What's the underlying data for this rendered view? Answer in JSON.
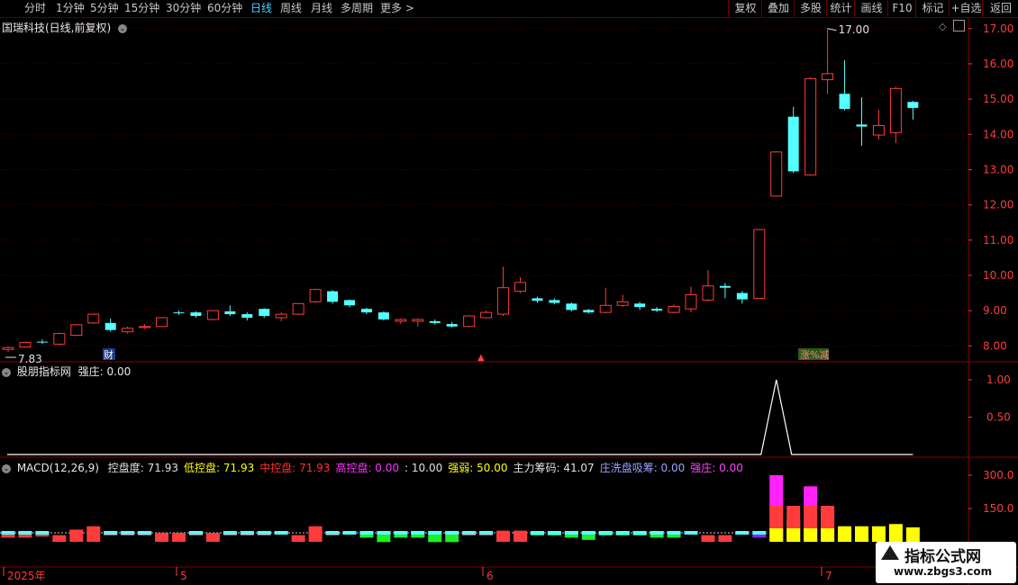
{
  "toolbar": {
    "periods": [
      "分时",
      "1分钟",
      "5分钟",
      "15分钟",
      "30分钟",
      "60分钟",
      "日线",
      "周线",
      "月线",
      "多周期",
      "更多 >"
    ],
    "active_period": "日线",
    "right_buttons": [
      "复权",
      "叠加",
      "多股",
      "统计",
      "画线",
      "F10",
      "标记",
      "+自选",
      "返回"
    ]
  },
  "main_panel": {
    "title": "国瑞科技(日线,前复权)",
    "y_ticks": [
      "17.00",
      "16.00",
      "15.00",
      "14.00",
      "13.00",
      "12.00",
      "11.00",
      "10.00",
      "9.00",
      "8.00"
    ],
    "high_label": "17.00",
    "low_label": "7.83",
    "markers": [
      "财",
      "▲",
      "涨%减"
    ]
  },
  "indicator_panel": {
    "name": "股朋指标网",
    "label": "强庄:",
    "value": "0.00",
    "y_ticks": [
      "1.00",
      "0.50"
    ]
  },
  "macd_panel": {
    "name": "MACD(12,26,9)",
    "items": [
      {
        "label": "控盘度:",
        "value": "71.93",
        "color": "#e0e0e0"
      },
      {
        "label": "低控盘:",
        "value": "71.93",
        "color": "#ffff00"
      },
      {
        "label": "中控盘:",
        "value": "71.93",
        "color": "#ff3030"
      },
      {
        "label": "高控盘:",
        "value": "0.00",
        "color": "#ff30ff"
      },
      {
        "label": ":",
        "value": "10.00",
        "color": "#e0e0e0"
      },
      {
        "label": "强弱:",
        "value": "50.00",
        "color": "#ffff00"
      },
      {
        "label": "主力筹码:",
        "value": "41.07",
        "color": "#e0e0e0"
      },
      {
        "label": "庄洗盘吸筹:",
        "value": "0.00",
        "color": "#a0a0ff"
      },
      {
        "label": "强庄:",
        "value": "0.00",
        "color": "#ff40ff"
      }
    ],
    "y_ticks": [
      "300.0",
      "150.0"
    ]
  },
  "time_axis": [
    "2025年",
    "5",
    "6",
    "7"
  ],
  "watermark": {
    "title": "指标公式网",
    "url": "www.zbgs3.com"
  },
  "chart_data": {
    "type": "candlestick",
    "title": "国瑞科技(日线,前复权)",
    "ylim": [
      7.6,
      17.3
    ],
    "candles": [
      {
        "o": 7.9,
        "c": 7.95,
        "h": 7.98,
        "l": 7.83
      },
      {
        "o": 7.97,
        "c": 8.1,
        "h": 8.12,
        "l": 7.95
      },
      {
        "o": 8.12,
        "c": 8.1,
        "h": 8.18,
        "l": 8.06
      },
      {
        "o": 8.05,
        "c": 8.35,
        "h": 8.38,
        "l": 8.02
      },
      {
        "o": 8.3,
        "c": 8.6,
        "h": 8.62,
        "l": 8.28
      },
      {
        "o": 8.65,
        "c": 8.9,
        "h": 8.92,
        "l": 8.62
      },
      {
        "o": 8.65,
        "c": 8.45,
        "h": 8.78,
        "l": 8.4
      },
      {
        "o": 8.4,
        "c": 8.5,
        "h": 8.55,
        "l": 8.35
      },
      {
        "o": 8.52,
        "c": 8.55,
        "h": 8.62,
        "l": 8.48
      },
      {
        "o": 8.55,
        "c": 8.8,
        "h": 8.82,
        "l": 8.53
      },
      {
        "o": 8.95,
        "c": 8.93,
        "h": 9.0,
        "l": 8.88
      },
      {
        "o": 8.95,
        "c": 8.85,
        "h": 8.98,
        "l": 8.8
      },
      {
        "o": 8.75,
        "c": 9.0,
        "h": 9.02,
        "l": 8.72
      },
      {
        "o": 8.98,
        "c": 8.9,
        "h": 9.15,
        "l": 8.85
      },
      {
        "o": 8.9,
        "c": 8.8,
        "h": 8.95,
        "l": 8.72
      },
      {
        "o": 9.05,
        "c": 8.85,
        "h": 9.07,
        "l": 8.8
      },
      {
        "o": 8.8,
        "c": 8.9,
        "h": 8.95,
        "l": 8.7
      },
      {
        "o": 8.9,
        "c": 9.2,
        "h": 9.22,
        "l": 8.88
      },
      {
        "o": 9.25,
        "c": 9.6,
        "h": 9.62,
        "l": 9.22
      },
      {
        "o": 9.55,
        "c": 9.25,
        "h": 9.58,
        "l": 9.2
      },
      {
        "o": 9.3,
        "c": 9.15,
        "h": 9.32,
        "l": 9.1
      },
      {
        "o": 9.05,
        "c": 8.95,
        "h": 9.08,
        "l": 8.9
      },
      {
        "o": 8.95,
        "c": 8.75,
        "h": 8.98,
        "l": 8.72
      },
      {
        "o": 8.7,
        "c": 8.75,
        "h": 8.78,
        "l": 8.62
      },
      {
        "o": 8.7,
        "c": 8.75,
        "h": 8.78,
        "l": 8.55
      },
      {
        "o": 8.7,
        "c": 8.65,
        "h": 8.75,
        "l": 8.6
      },
      {
        "o": 8.62,
        "c": 8.55,
        "h": 8.68,
        "l": 8.52
      },
      {
        "o": 8.55,
        "c": 8.85,
        "h": 8.87,
        "l": 8.53
      },
      {
        "o": 8.8,
        "c": 8.95,
        "h": 9.0,
        "l": 8.78
      },
      {
        "o": 8.9,
        "c": 9.65,
        "h": 10.25,
        "l": 8.85
      },
      {
        "o": 9.55,
        "c": 9.8,
        "h": 9.95,
        "l": 9.5
      },
      {
        "o": 9.35,
        "c": 9.28,
        "h": 9.4,
        "l": 9.22
      },
      {
        "o": 9.3,
        "c": 9.22,
        "h": 9.35,
        "l": 9.18
      },
      {
        "o": 9.2,
        "c": 9.02,
        "h": 9.23,
        "l": 8.98
      },
      {
        "o": 9.02,
        "c": 8.95,
        "h": 9.05,
        "l": 8.92
      },
      {
        "o": 8.95,
        "c": 9.15,
        "h": 9.65,
        "l": 8.92
      },
      {
        "o": 9.15,
        "c": 9.25,
        "h": 9.45,
        "l": 9.1
      },
      {
        "o": 9.2,
        "c": 9.1,
        "h": 9.25,
        "l": 9.02
      },
      {
        "o": 9.05,
        "c": 9.0,
        "h": 9.1,
        "l": 8.96
      },
      {
        "o": 8.95,
        "c": 9.12,
        "h": 9.17,
        "l": 8.93
      },
      {
        "o": 9.05,
        "c": 9.45,
        "h": 9.68,
        "l": 8.95
      },
      {
        "o": 9.3,
        "c": 9.7,
        "h": 10.15,
        "l": 9.25
      },
      {
        "o": 9.7,
        "c": 9.65,
        "h": 9.78,
        "l": 9.35
      },
      {
        "o": 9.5,
        "c": 9.32,
        "h": 9.55,
        "l": 9.2
      },
      {
        "o": 9.35,
        "c": 11.3,
        "h": 11.32,
        "l": 9.33
      },
      {
        "o": 12.25,
        "c": 13.5,
        "h": 13.52,
        "l": 12.23
      },
      {
        "o": 14.5,
        "c": 12.95,
        "h": 14.78,
        "l": 12.9
      },
      {
        "o": 12.85,
        "c": 15.58,
        "h": 15.62,
        "l": 12.83
      },
      {
        "o": 15.55,
        "c": 15.72,
        "h": 17.0,
        "l": 15.15
      },
      {
        "o": 15.15,
        "c": 14.72,
        "h": 16.1,
        "l": 14.68
      },
      {
        "o": 14.28,
        "c": 14.22,
        "h": 15.05,
        "l": 13.68
      },
      {
        "o": 13.98,
        "c": 14.25,
        "h": 14.7,
        "l": 13.85
      },
      {
        "o": 14.05,
        "c": 15.3,
        "h": 15.35,
        "l": 13.75
      },
      {
        "o": 14.92,
        "c": 14.75,
        "h": 14.95,
        "l": 14.42
      }
    ],
    "strong_line": {
      "values_note": "spike",
      "spike_index": 45,
      "value": 1.0
    },
    "ctrl_bars": [
      {
        "v": -30,
        "c": "up"
      },
      {
        "v": -30,
        "c": "up"
      },
      {
        "v": -25,
        "c": "up"
      },
      {
        "v": 30,
        "c": "up"
      },
      {
        "v": 55,
        "c": "up"
      },
      {
        "v": 70,
        "c": "up"
      },
      {
        "v": -20,
        "c": "up"
      },
      {
        "v": -20,
        "c": "up"
      },
      {
        "v": -20,
        "c": "up"
      },
      {
        "v": 40,
        "c": "up"
      },
      {
        "v": 40,
        "c": "up"
      },
      {
        "v": -20,
        "c": "up"
      },
      {
        "v": 40,
        "c": "up"
      },
      {
        "v": -20,
        "c": "up"
      },
      {
        "v": -20,
        "c": "up"
      },
      {
        "v": -20,
        "c": "up"
      },
      {
        "v": -10,
        "c": "dn"
      },
      {
        "v": 30,
        "c": "up"
      },
      {
        "v": 70,
        "c": "up"
      },
      {
        "v": -20,
        "c": "up"
      },
      {
        "v": -10,
        "c": "up"
      },
      {
        "v": -30,
        "c": "dn"
      },
      {
        "v": -50,
        "c": "dn"
      },
      {
        "v": -30,
        "c": "dn"
      },
      {
        "v": -30,
        "c": "dn"
      },
      {
        "v": -50,
        "c": "dn"
      },
      {
        "v": -50,
        "c": "dn"
      },
      {
        "v": -20,
        "c": "up"
      },
      {
        "v": -20,
        "c": "up"
      },
      {
        "v": 50,
        "c": "up"
      },
      {
        "v": 50,
        "c": "up"
      },
      {
        "v": -20,
        "c": "dn"
      },
      {
        "v": -20,
        "c": "dn"
      },
      {
        "v": -30,
        "c": "dn"
      },
      {
        "v": -40,
        "c": "dn"
      },
      {
        "v": -20,
        "c": "dn"
      },
      {
        "v": -20,
        "c": "dn"
      },
      {
        "v": -20,
        "c": "dn"
      },
      {
        "v": -30,
        "c": "dn"
      },
      {
        "v": -30,
        "c": "dn"
      },
      {
        "v": -15,
        "c": "up"
      },
      {
        "v": 30,
        "c": "up"
      },
      {
        "v": 30,
        "c": "up"
      },
      {
        "v": -15,
        "c": "up"
      },
      {
        "v": -30,
        "c": "pur"
      },
      {
        "v": 300,
        "c": "hi"
      },
      {
        "v": 100,
        "c": "mid"
      },
      {
        "v": 250,
        "c": "hi"
      },
      {
        "v": 150,
        "c": "mid"
      },
      {
        "v": 70,
        "c": "yl"
      },
      {
        "v": 70,
        "c": "yl"
      },
      {
        "v": 70,
        "c": "yl"
      },
      {
        "v": 80,
        "c": "yl"
      },
      {
        "v": 65,
        "c": "yl"
      }
    ]
  }
}
